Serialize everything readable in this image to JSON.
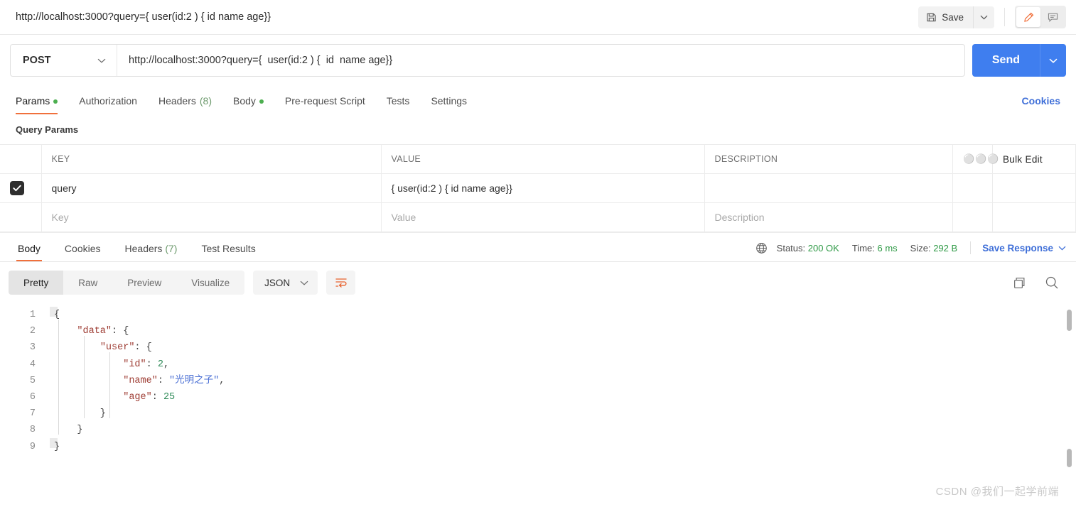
{
  "topbar": {
    "request_title": "http://localhost:3000?query={ user(id:2 ) { id name age}}",
    "save_label": "Save",
    "save_icon": "floppy-disk-icon",
    "save_caret_icon": "chevron-down-icon",
    "edit_icon": "pencil-icon",
    "comment_icon": "comment-icon"
  },
  "url_bar": {
    "method": "POST",
    "method_caret_icon": "chevron-down-icon",
    "url_value": "http://localhost:3000?query={  user(id:2 ) {  id  name age}}",
    "send_label": "Send",
    "send_caret_icon": "chevron-down-icon"
  },
  "request_tabs": {
    "items": [
      {
        "label": "Params",
        "dot": true,
        "count": "",
        "active": true
      },
      {
        "label": "Authorization",
        "dot": false,
        "count": "",
        "active": false
      },
      {
        "label": "Headers",
        "dot": false,
        "count": "(8)",
        "active": false
      },
      {
        "label": "Body",
        "dot": true,
        "count": "",
        "active": false
      },
      {
        "label": "Pre-request Script",
        "dot": false,
        "count": "",
        "active": false
      },
      {
        "label": "Tests",
        "dot": false,
        "count": "",
        "active": false
      },
      {
        "label": "Settings",
        "dot": false,
        "count": "",
        "active": false
      }
    ],
    "cookies_label": "Cookies"
  },
  "query_params": {
    "section_label": "Query Params",
    "headers": {
      "key": "KEY",
      "value": "VALUE",
      "description": "DESCRIPTION",
      "more_icon": "more-options-icon",
      "bulk_edit": "Bulk Edit"
    },
    "rows": [
      {
        "checked": true,
        "key": "query",
        "value": "{  user(id:2 ) {  id  name age}}",
        "description": ""
      }
    ],
    "empty_row": {
      "key_placeholder": "Key",
      "value_placeholder": "Value",
      "description_placeholder": "Description"
    }
  },
  "response": {
    "tabs": [
      {
        "label": "Body",
        "count": "",
        "active": true
      },
      {
        "label": "Cookies",
        "count": "",
        "active": false
      },
      {
        "label": "Headers",
        "count": "(7)",
        "active": false
      },
      {
        "label": "Test Results",
        "count": "",
        "active": false
      }
    ],
    "globe_icon": "globe-icon",
    "status_label": "Status:",
    "status_value": "200 OK",
    "time_label": "Time:",
    "time_value": "6 ms",
    "size_label": "Size:",
    "size_value": "292 B",
    "save_response_label": "Save Response",
    "save_response_caret_icon": "chevron-down-icon",
    "view_modes": [
      {
        "label": "Pretty",
        "active": true
      },
      {
        "label": "Raw",
        "active": false
      },
      {
        "label": "Preview",
        "active": false
      },
      {
        "label": "Visualize",
        "active": false
      }
    ],
    "format": "JSON",
    "format_caret_icon": "chevron-down-icon",
    "wrap_icon": "wrap-lines-icon",
    "copy_icon": "copy-icon",
    "search_icon": "search-icon"
  },
  "code": {
    "language": "json",
    "line_count": 9,
    "lines": [
      {
        "n": 1,
        "tokens": [
          {
            "t": "{",
            "c": "p"
          }
        ]
      },
      {
        "n": 2,
        "tokens": [
          {
            "t": "    ",
            "c": "p"
          },
          {
            "t": "\"data\"",
            "c": "k"
          },
          {
            "t": ": {",
            "c": "p"
          }
        ]
      },
      {
        "n": 3,
        "tokens": [
          {
            "t": "        ",
            "c": "p"
          },
          {
            "t": "\"user\"",
            "c": "k"
          },
          {
            "t": ": {",
            "c": "p"
          }
        ]
      },
      {
        "n": 4,
        "tokens": [
          {
            "t": "            ",
            "c": "p"
          },
          {
            "t": "\"id\"",
            "c": "k"
          },
          {
            "t": ": ",
            "c": "p"
          },
          {
            "t": "2",
            "c": "n"
          },
          {
            "t": ",",
            "c": "p"
          }
        ]
      },
      {
        "n": 5,
        "tokens": [
          {
            "t": "            ",
            "c": "p"
          },
          {
            "t": "\"name\"",
            "c": "k"
          },
          {
            "t": ": ",
            "c": "p"
          },
          {
            "t": "\"光明之子\"",
            "c": "s"
          },
          {
            "t": ",",
            "c": "p"
          }
        ]
      },
      {
        "n": 6,
        "tokens": [
          {
            "t": "            ",
            "c": "p"
          },
          {
            "t": "\"age\"",
            "c": "k"
          },
          {
            "t": ": ",
            "c": "p"
          },
          {
            "t": "25",
            "c": "n"
          }
        ]
      },
      {
        "n": 7,
        "tokens": [
          {
            "t": "        }",
            "c": "p"
          }
        ]
      },
      {
        "n": 8,
        "tokens": [
          {
            "t": "    }",
            "c": "p"
          }
        ]
      },
      {
        "n": 9,
        "tokens": [
          {
            "t": "}",
            "c": "p"
          }
        ]
      }
    ],
    "parsed": {
      "data": {
        "user": {
          "id": 2,
          "name": "光明之子",
          "age": 25
        }
      }
    }
  },
  "watermark": "CSDN @我们一起学前端",
  "colors": {
    "accent_orange": "#f0703c",
    "send_blue": "#3f7eef",
    "link_blue": "#3f6fd8",
    "status_green": "#2f9a46",
    "dot_green": "#4caf50"
  }
}
